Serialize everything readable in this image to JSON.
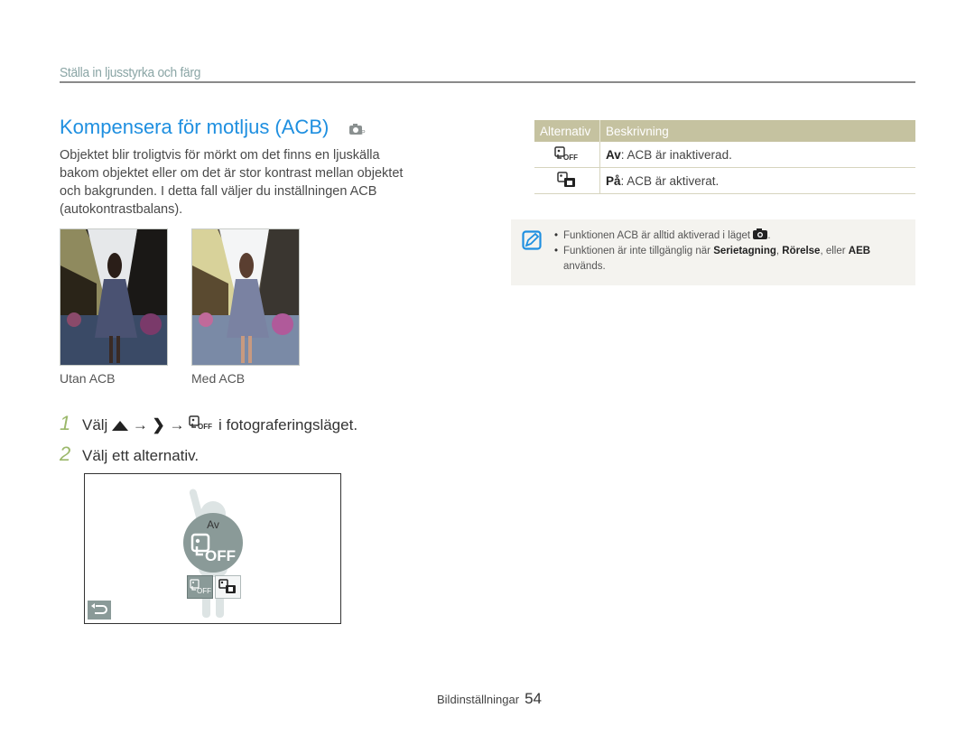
{
  "section_title": "Ställa in ljusstyrka och färg",
  "heading": "Kompensera för motljus (ACB)",
  "heading_icon": "camera-program-mode-icon",
  "intro": "Objektet blir troligtvis för mörkt om det finns en ljuskälla bakom objektet eller om det är stor kontrast mellan objektet och bakgrunden. I detta fall väljer du inställningen ACB (autokontrastbalans).",
  "photos": [
    {
      "caption": "Utan ACB",
      "description": "woman in dress walking on street, dark"
    },
    {
      "caption": "Med ACB",
      "description": "woman in dress walking on street, brightened"
    }
  ],
  "steps": [
    {
      "num": "1",
      "prefix": "Välj",
      "arrow": "→",
      "suffix": "i fotograferingsläget.",
      "icons": [
        "up-triangle-icon",
        "chevron-right-icon",
        "acb-off-icon"
      ]
    },
    {
      "num": "2",
      "text": "Välj ett alternativ."
    }
  ],
  "screen": {
    "selected_label": "Av",
    "selected_icon_text": "OFF",
    "options": [
      "acb-off-icon",
      "acb-on-icon"
    ],
    "back_icon": "back-icon"
  },
  "table": {
    "headers": [
      "Alternativ",
      "Beskrivning"
    ],
    "rows": [
      {
        "icon": "acb-off-icon",
        "term": "Av",
        "desc": ": ACB är inaktiverad."
      },
      {
        "icon": "acb-on-icon",
        "term": "På",
        "desc": ": ACB är aktiverat."
      }
    ]
  },
  "note": {
    "icon": "note-pencil-icon",
    "items": [
      {
        "text": "Funktionen ACB är alltid aktiverad i läget",
        "icon": "camera-icon",
        "end": "."
      },
      {
        "pre": "Funktionen är inte tillgänglig när ",
        "b1": "Serietagning",
        "mid1": ", ",
        "b2": "Rörelse",
        "mid2": ", eller ",
        "b3": "AEB",
        "end": " används."
      }
    ]
  },
  "footer": {
    "section": "Bildinställningar",
    "page": "54"
  },
  "colors": {
    "accent_blue": "#1e8fe0",
    "table_header": "#c5c2a0",
    "step_number": "#9bb86a",
    "note_bg": "#f4f3ef"
  }
}
